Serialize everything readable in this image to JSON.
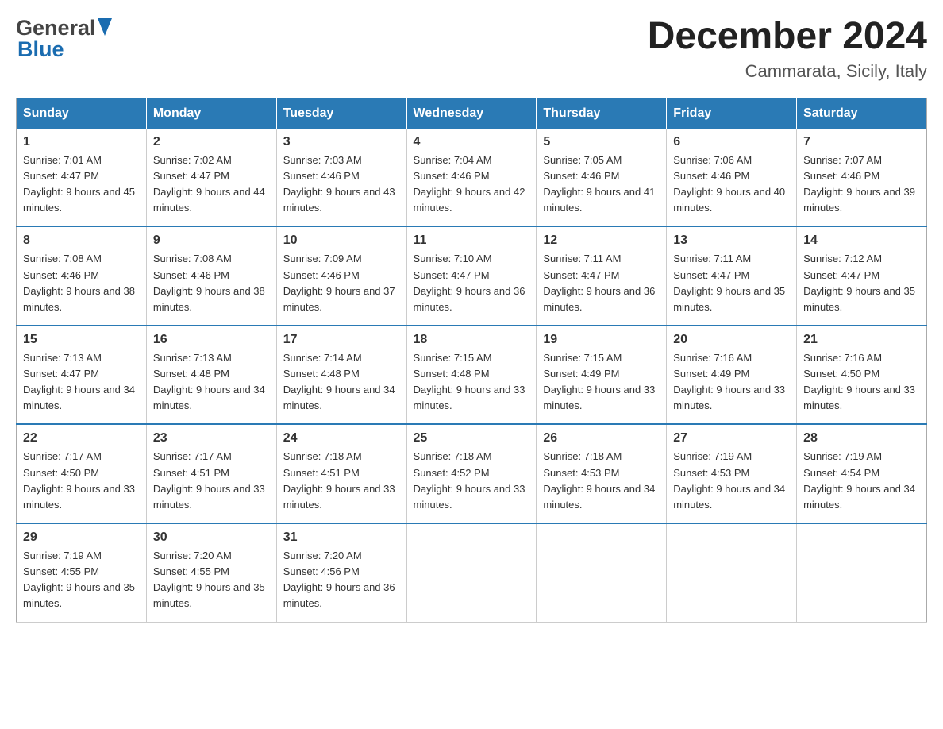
{
  "header": {
    "logo_general": "General",
    "logo_blue": "Blue",
    "month_title": "December 2024",
    "location": "Cammarata, Sicily, Italy"
  },
  "days_of_week": [
    "Sunday",
    "Monday",
    "Tuesday",
    "Wednesday",
    "Thursday",
    "Friday",
    "Saturday"
  ],
  "weeks": [
    [
      {
        "day": "1",
        "sunrise": "7:01 AM",
        "sunset": "4:47 PM",
        "daylight": "9 hours and 45 minutes."
      },
      {
        "day": "2",
        "sunrise": "7:02 AM",
        "sunset": "4:47 PM",
        "daylight": "9 hours and 44 minutes."
      },
      {
        "day": "3",
        "sunrise": "7:03 AM",
        "sunset": "4:46 PM",
        "daylight": "9 hours and 43 minutes."
      },
      {
        "day": "4",
        "sunrise": "7:04 AM",
        "sunset": "4:46 PM",
        "daylight": "9 hours and 42 minutes."
      },
      {
        "day": "5",
        "sunrise": "7:05 AM",
        "sunset": "4:46 PM",
        "daylight": "9 hours and 41 minutes."
      },
      {
        "day": "6",
        "sunrise": "7:06 AM",
        "sunset": "4:46 PM",
        "daylight": "9 hours and 40 minutes."
      },
      {
        "day": "7",
        "sunrise": "7:07 AM",
        "sunset": "4:46 PM",
        "daylight": "9 hours and 39 minutes."
      }
    ],
    [
      {
        "day": "8",
        "sunrise": "7:08 AM",
        "sunset": "4:46 PM",
        "daylight": "9 hours and 38 minutes."
      },
      {
        "day": "9",
        "sunrise": "7:08 AM",
        "sunset": "4:46 PM",
        "daylight": "9 hours and 38 minutes."
      },
      {
        "day": "10",
        "sunrise": "7:09 AM",
        "sunset": "4:46 PM",
        "daylight": "9 hours and 37 minutes."
      },
      {
        "day": "11",
        "sunrise": "7:10 AM",
        "sunset": "4:47 PM",
        "daylight": "9 hours and 36 minutes."
      },
      {
        "day": "12",
        "sunrise": "7:11 AM",
        "sunset": "4:47 PM",
        "daylight": "9 hours and 36 minutes."
      },
      {
        "day": "13",
        "sunrise": "7:11 AM",
        "sunset": "4:47 PM",
        "daylight": "9 hours and 35 minutes."
      },
      {
        "day": "14",
        "sunrise": "7:12 AM",
        "sunset": "4:47 PM",
        "daylight": "9 hours and 35 minutes."
      }
    ],
    [
      {
        "day": "15",
        "sunrise": "7:13 AM",
        "sunset": "4:47 PM",
        "daylight": "9 hours and 34 minutes."
      },
      {
        "day": "16",
        "sunrise": "7:13 AM",
        "sunset": "4:48 PM",
        "daylight": "9 hours and 34 minutes."
      },
      {
        "day": "17",
        "sunrise": "7:14 AM",
        "sunset": "4:48 PM",
        "daylight": "9 hours and 34 minutes."
      },
      {
        "day": "18",
        "sunrise": "7:15 AM",
        "sunset": "4:48 PM",
        "daylight": "9 hours and 33 minutes."
      },
      {
        "day": "19",
        "sunrise": "7:15 AM",
        "sunset": "4:49 PM",
        "daylight": "9 hours and 33 minutes."
      },
      {
        "day": "20",
        "sunrise": "7:16 AM",
        "sunset": "4:49 PM",
        "daylight": "9 hours and 33 minutes."
      },
      {
        "day": "21",
        "sunrise": "7:16 AM",
        "sunset": "4:50 PM",
        "daylight": "9 hours and 33 minutes."
      }
    ],
    [
      {
        "day": "22",
        "sunrise": "7:17 AM",
        "sunset": "4:50 PM",
        "daylight": "9 hours and 33 minutes."
      },
      {
        "day": "23",
        "sunrise": "7:17 AM",
        "sunset": "4:51 PM",
        "daylight": "9 hours and 33 minutes."
      },
      {
        "day": "24",
        "sunrise": "7:18 AM",
        "sunset": "4:51 PM",
        "daylight": "9 hours and 33 minutes."
      },
      {
        "day": "25",
        "sunrise": "7:18 AM",
        "sunset": "4:52 PM",
        "daylight": "9 hours and 33 minutes."
      },
      {
        "day": "26",
        "sunrise": "7:18 AM",
        "sunset": "4:53 PM",
        "daylight": "9 hours and 34 minutes."
      },
      {
        "day": "27",
        "sunrise": "7:19 AM",
        "sunset": "4:53 PM",
        "daylight": "9 hours and 34 minutes."
      },
      {
        "day": "28",
        "sunrise": "7:19 AM",
        "sunset": "4:54 PM",
        "daylight": "9 hours and 34 minutes."
      }
    ],
    [
      {
        "day": "29",
        "sunrise": "7:19 AM",
        "sunset": "4:55 PM",
        "daylight": "9 hours and 35 minutes."
      },
      {
        "day": "30",
        "sunrise": "7:20 AM",
        "sunset": "4:55 PM",
        "daylight": "9 hours and 35 minutes."
      },
      {
        "day": "31",
        "sunrise": "7:20 AM",
        "sunset": "4:56 PM",
        "daylight": "9 hours and 36 minutes."
      },
      null,
      null,
      null,
      null
    ]
  ],
  "labels": {
    "sunrise_prefix": "Sunrise: ",
    "sunset_prefix": "Sunset: ",
    "daylight_prefix": "Daylight: "
  }
}
